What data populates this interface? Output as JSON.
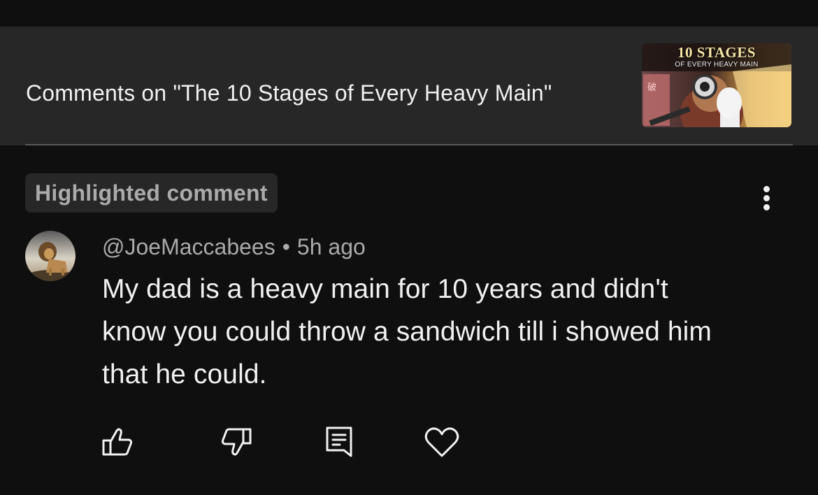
{
  "header": {
    "title": "Comments on \"The 10 Stages of Every Heavy Main\"",
    "thumbnail": {
      "title": "10 STAGES",
      "subtitle": "OF EVERY HEAVY MAIN",
      "stamp": "破"
    }
  },
  "highlight": {
    "label": "Highlighted comment"
  },
  "comment": {
    "author": "@JoeMaccabees",
    "separator": "•",
    "time": "5h ago",
    "text": "My dad is a heavy main for 10 years and didn't know you could throw a sandwich till i showed him that he could."
  },
  "actions": {
    "icons": [
      "thumbs-up-icon",
      "thumbs-down-icon",
      "reply-icon",
      "heart-icon"
    ]
  },
  "colors": {
    "background": "#0f0f0f",
    "header_bg": "#272727",
    "text_primary": "#f1f1f1",
    "text_secondary": "#aaaaaa"
  }
}
